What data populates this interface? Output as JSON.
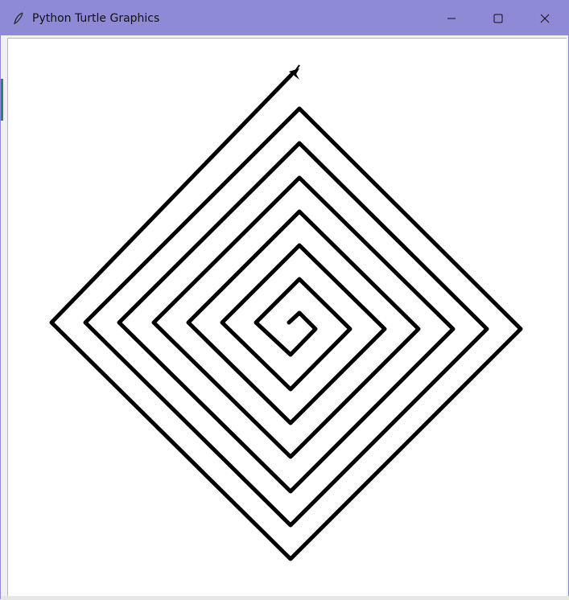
{
  "window": {
    "title": "Python Turtle Graphics",
    "titlebar_color": "#8f8ad6",
    "icons": {
      "app": "feather-icon",
      "minimize": "minimize-icon",
      "maximize": "maximize-icon",
      "close": "close-icon"
    }
  },
  "drawing": {
    "stroke_color": "#000000",
    "background": "#ffffff",
    "shape": "square-spiral",
    "turtle_icon": "turtle-arrow-icon"
  }
}
